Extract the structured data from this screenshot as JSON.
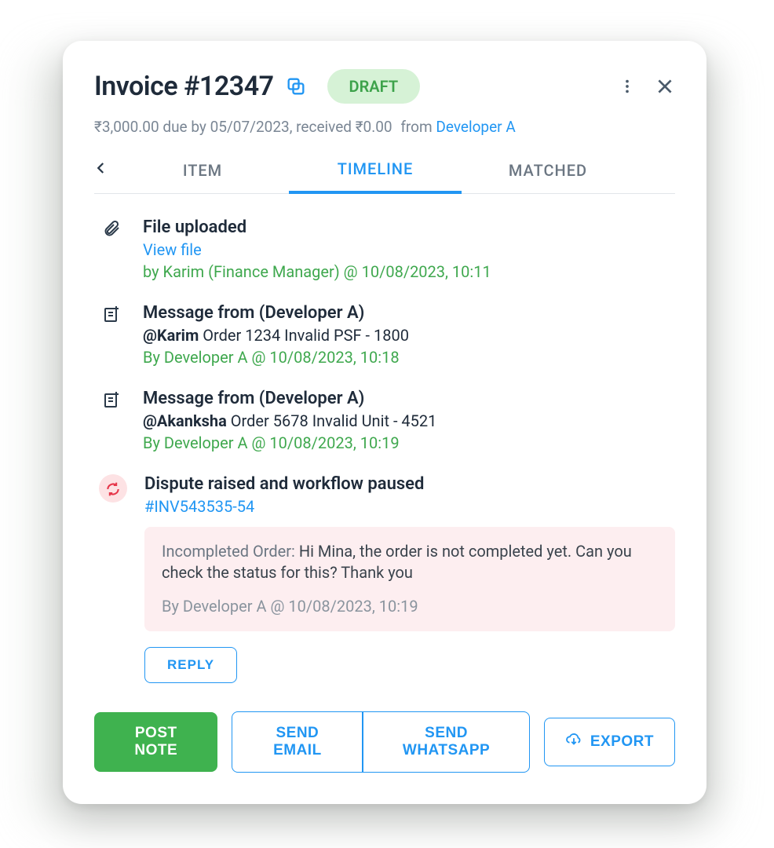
{
  "header": {
    "title": "Invoice #12347",
    "status": "DRAFT",
    "due_line": "₹3,000.00 due by 05/07/2023, received ₹0.00",
    "from_label": "from",
    "from_name": "Developer A"
  },
  "tabs": {
    "item": "ITEM",
    "timeline": "TIMELINE",
    "matched": "MATCHED",
    "active": "timeline"
  },
  "timeline": [
    {
      "icon": "attachment-icon",
      "title": "File uploaded",
      "link": "View file",
      "meta": "by Karim (Finance Manager) @ 10/08/2023, 10:11"
    },
    {
      "icon": "note-icon",
      "title": "Message from (Developer A)",
      "mention": "@Karim",
      "message": "Order 1234 Invalid PSF - 1800",
      "meta": "By Developer A @ 10/08/2023, 10:18"
    },
    {
      "icon": "note-icon",
      "title": "Message from (Developer A)",
      "mention": "@Akanksha",
      "message": "Order 5678 Invalid Unit - 4521",
      "meta": "By Developer A @ 10/08/2023, 10:19"
    },
    {
      "icon": "dispute-icon",
      "title": "Dispute raised and workflow paused",
      "ref": "#INV543535-54",
      "box_label": "Incompleted Order:",
      "box_text": "Hi Mina, the order is not completed yet. Can you check the status for this? Thank you",
      "box_by": "By Developer A @ 10/08/2023, 10:19"
    }
  ],
  "reply_label": "REPLY",
  "footer": {
    "post_note": "POST NOTE",
    "send_email": "SEND EMAIL",
    "send_whatsapp": "SEND WHATSAPP",
    "export": "EXPORT"
  }
}
